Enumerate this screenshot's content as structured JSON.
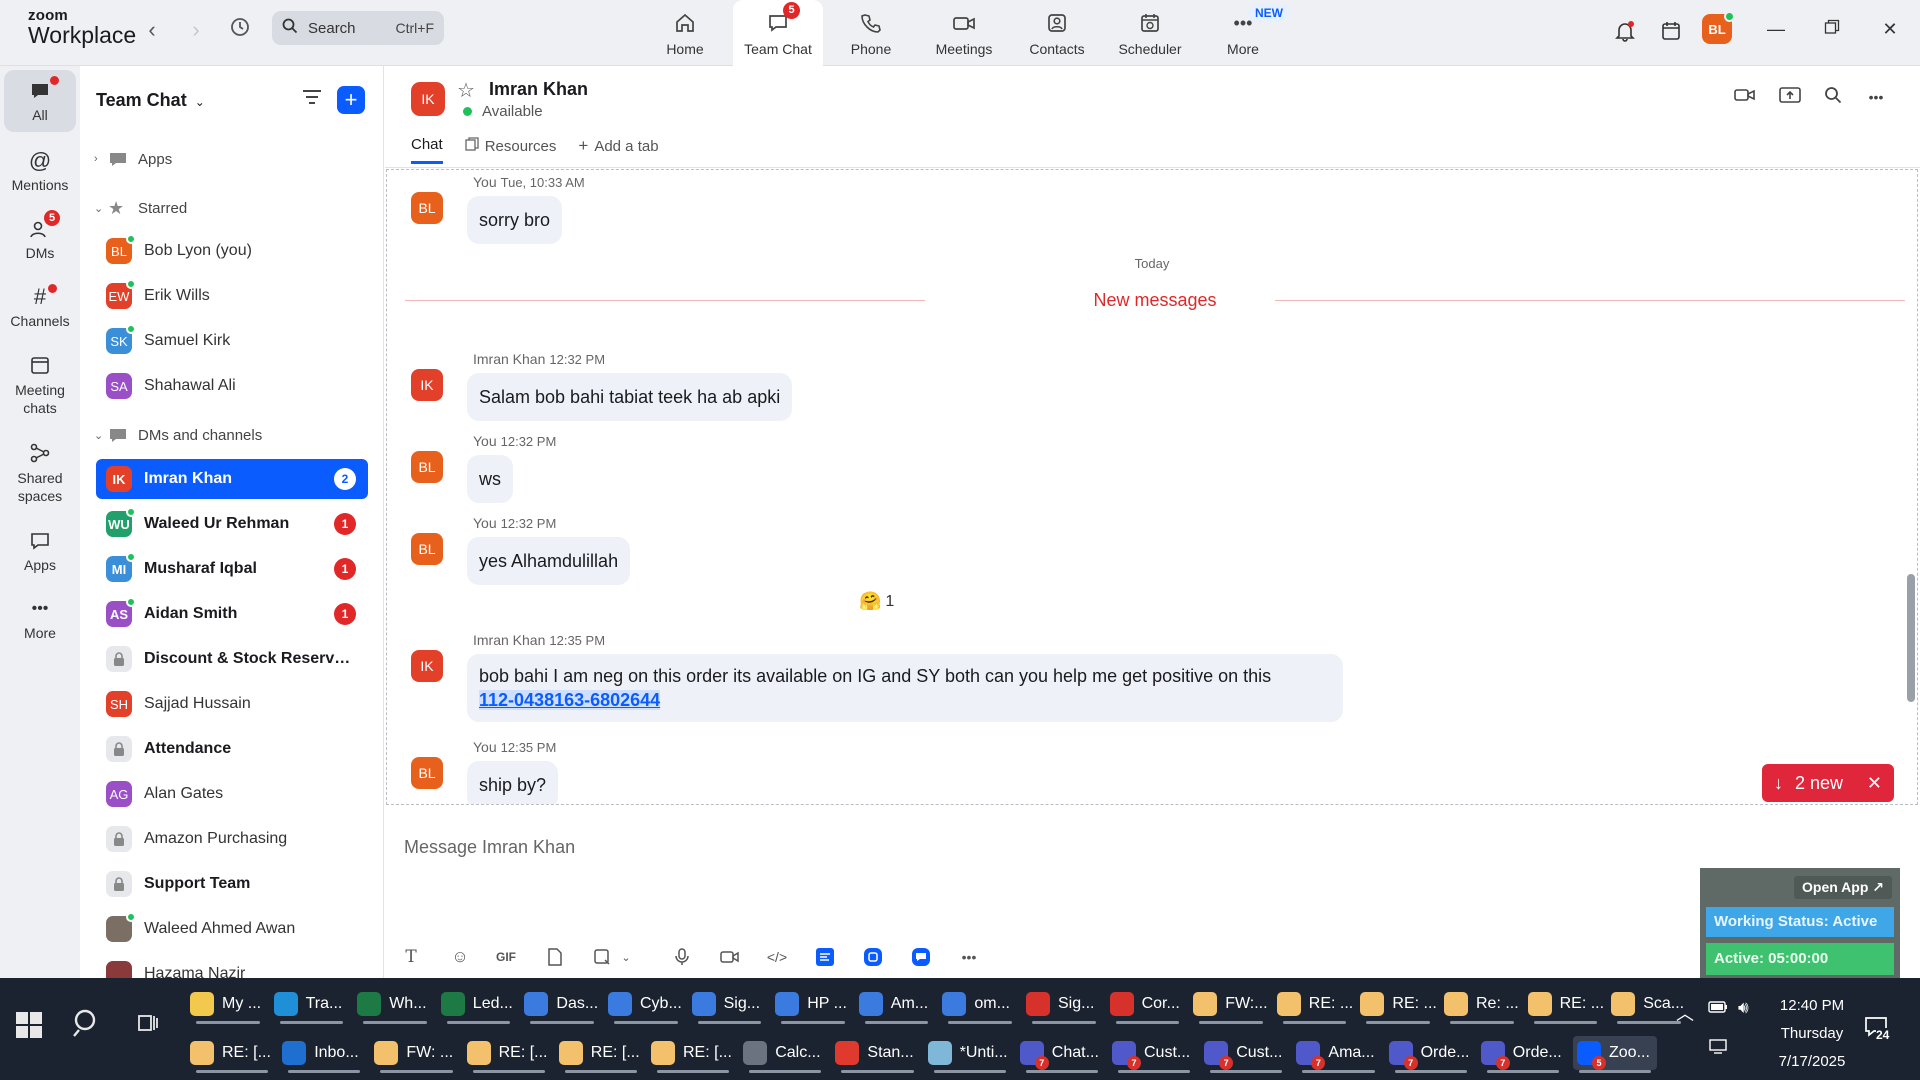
{
  "app": {
    "logo_line1": "zoom",
    "logo_line2": "Workplace"
  },
  "search": {
    "label": "Search",
    "shortcut": "Ctrl+F"
  },
  "top_tabs": [
    {
      "label": "Home",
      "icon": "home-icon"
    },
    {
      "label": "Team Chat",
      "icon": "chat-bubble-icon",
      "badge": "5",
      "active": true
    },
    {
      "label": "Phone",
      "icon": "phone-icon"
    },
    {
      "label": "Meetings",
      "icon": "video-camera-icon"
    },
    {
      "label": "Contacts",
      "icon": "contacts-icon"
    },
    {
      "label": "Scheduler",
      "icon": "calendar-clock-icon"
    },
    {
      "label": "More",
      "icon": "more-dots-icon",
      "pill": "NEW"
    }
  ],
  "user_avatar": {
    "initials": "BL",
    "color": "#e8611c"
  },
  "rail": [
    {
      "label": "All",
      "icon": "chat-bubble-icon",
      "active": true
    },
    {
      "label": "Mentions",
      "icon": "at-icon"
    },
    {
      "label": "DMs",
      "icon": "people-icon",
      "badge": "5"
    },
    {
      "label": "Channels",
      "icon": "hash-icon"
    },
    {
      "label": "Meeting chats",
      "icon": "calendar-icon"
    },
    {
      "label": "Shared spaces",
      "icon": "share-icon"
    },
    {
      "label": "Apps",
      "icon": "apps-icon"
    },
    {
      "label": "More",
      "icon": "more-dots-icon"
    }
  ],
  "sidebar": {
    "title": "Team Chat",
    "sections": {
      "apps": "Apps",
      "starred": "Starred",
      "dms": "DMs and channels"
    },
    "starred": [
      {
        "initials": "BL",
        "name": "Bob Lyon (you)",
        "color": "#e8611c"
      },
      {
        "initials": "EW",
        "name": "Erik Wills",
        "color": "#e3402a"
      },
      {
        "initials": "SK",
        "name": "Samuel Kirk",
        "color": "#3a8fd8"
      },
      {
        "initials": "SA",
        "name": "Shahawal Ali",
        "color": "#9b4fc7"
      }
    ],
    "items": [
      {
        "initials": "IK",
        "name": "Imran Khan",
        "color": "#e3402a",
        "count": "2",
        "bold": true,
        "active": true
      },
      {
        "initials": "WU",
        "name": "Waleed Ur Rehman",
        "color": "#22a06b",
        "count": "1",
        "bold": true
      },
      {
        "initials": "MI",
        "name": "Musharaf Iqbal",
        "color": "#3a8fd8",
        "count": "1",
        "bold": true
      },
      {
        "initials": "AS",
        "name": "Aidan Smith",
        "color": "#9b4fc7",
        "count": "1",
        "bold": true
      },
      {
        "lock": true,
        "name": "Discount & Stock Reserva...",
        "bold": true
      },
      {
        "initials": "SH",
        "name": "Sajjad Hussain",
        "color": "#e3402a"
      },
      {
        "lock": true,
        "name": "Attendance",
        "bold": true
      },
      {
        "initials": "AG",
        "name": "Alan Gates",
        "color": "#9b4fc7"
      },
      {
        "lock": true,
        "name": "Amazon Purchasing"
      },
      {
        "lock": true,
        "name": "Support Team",
        "bold": true
      },
      {
        "initials": "",
        "name": "Waleed Ahmed Awan",
        "color": "#7a6f62"
      },
      {
        "initials": "",
        "name": "Hazama Nazir",
        "color": "#8a3a3a"
      }
    ]
  },
  "chat": {
    "contact": {
      "initials": "IK",
      "name": "Imran Khan",
      "status": "Available"
    },
    "tabs": [
      "Chat",
      "Resources",
      "Add a tab"
    ],
    "day_separator": "Today",
    "new_messages_label": "New messages",
    "messages": [
      {
        "sender": "You",
        "time": "Tue, 10:33 AM",
        "initials": "BL",
        "color": "#e8611c",
        "text": "sorry bro"
      },
      {
        "sender": "Imran Khan",
        "time": "12:32 PM",
        "initials": "IK",
        "color": "#e3402a",
        "text": "Salam bob bahi  tabiat teek ha ab apki"
      },
      {
        "sender": "You",
        "time": "12:32 PM",
        "initials": "BL",
        "color": "#e8611c",
        "text": "ws"
      },
      {
        "sender": "You",
        "time": "12:32 PM",
        "initials": "BL",
        "color": "#e8611c",
        "text": "yes Alhamdulillah",
        "reaction": "1"
      },
      {
        "sender": "Imran Khan",
        "time": "12:35 PM",
        "initials": "IK",
        "color": "#e3402a",
        "text": "bob bahi  I am neg on this order  its available on IG and SY both can you help me get positive on this",
        "link": "112-0438163-6802644"
      },
      {
        "sender": "You",
        "time": "12:35 PM",
        "initials": "BL",
        "color": "#e8611c",
        "text": "ship by?"
      }
    ],
    "new_pill": "2 new",
    "composer_placeholder": "Message Imran Khan"
  },
  "floating_widget": {
    "open_app": "Open App ↗",
    "working_status": "Working Status: Active",
    "active_timer": "Active: 05:00:00"
  },
  "taskbar": {
    "row1": [
      {
        "label": "My ...",
        "icon": "folder-icon",
        "color": "#f2c94c"
      },
      {
        "label": "Tra...",
        "icon": "edge-icon",
        "color": "#1f8fd8"
      },
      {
        "label": "Wh...",
        "icon": "excel-icon",
        "color": "#1d7a45"
      },
      {
        "label": "Led...",
        "icon": "excel-icon",
        "color": "#1d7a45"
      },
      {
        "label": "Das...",
        "icon": "chrome-icon",
        "color": "#3b7be0"
      },
      {
        "label": "Cyb...",
        "icon": "chrome-icon",
        "color": "#3b7be0"
      },
      {
        "label": "Sig...",
        "icon": "chrome-icon",
        "color": "#3b7be0"
      },
      {
        "label": "HP ...",
        "icon": "chrome-icon",
        "color": "#3b7be0"
      },
      {
        "label": "Am...",
        "icon": "chrome-icon",
        "color": "#3b7be0"
      },
      {
        "label": "om...",
        "icon": "chrome-icon",
        "color": "#3b7be0"
      },
      {
        "label": "Sig...",
        "icon": "chrome-icon",
        "color": "#d6322b"
      },
      {
        "label": "Cor...",
        "icon": "chrome-icon",
        "color": "#d6322b"
      },
      {
        "label": "FW:...",
        "icon": "mail-icon",
        "color": "#f3c16b"
      },
      {
        "label": "RE: ...",
        "icon": "mail-icon",
        "color": "#f3c16b"
      },
      {
        "label": "RE: ...",
        "icon": "mail-icon",
        "color": "#f3c16b"
      },
      {
        "label": "Re: ...",
        "icon": "mail-icon",
        "color": "#f3c16b"
      },
      {
        "label": "RE: ...",
        "icon": "mail-icon",
        "color": "#f3c16b"
      },
      {
        "label": "Sca...",
        "icon": "mail-icon",
        "color": "#f3c16b"
      }
    ],
    "row2": [
      {
        "label": "RE: [...",
        "icon": "mail-icon",
        "color": "#f3c16b"
      },
      {
        "label": "Inbo...",
        "icon": "outlook-icon",
        "color": "#1f6fd0"
      },
      {
        "label": "FW: ...",
        "icon": "mail-icon",
        "color": "#f3c16b"
      },
      {
        "label": "RE: [...",
        "icon": "mail-icon",
        "color": "#f3c16b"
      },
      {
        "label": "RE: [...",
        "icon": "mail-icon",
        "color": "#f3c16b"
      },
      {
        "label": "RE: [...",
        "icon": "mail-icon",
        "color": "#f3c16b"
      },
      {
        "label": "Calc...",
        "icon": "calculator-icon",
        "color": "#6b7380"
      },
      {
        "label": "Stan...",
        "icon": "pdf-icon",
        "color": "#e03a2f"
      },
      {
        "label": "*Unti...",
        "icon": "notepad-icon",
        "color": "#7fb7d9"
      },
      {
        "label": "Chat...",
        "icon": "teams-icon",
        "color": "#5059c9",
        "badge": "7"
      },
      {
        "label": "Cust...",
        "icon": "teams-icon",
        "color": "#5059c9",
        "badge": "7"
      },
      {
        "label": "Cust...",
        "icon": "teams-icon",
        "color": "#5059c9",
        "badge": "7"
      },
      {
        "label": "Ama...",
        "icon": "teams-icon",
        "color": "#5059c9",
        "badge": "7"
      },
      {
        "label": "Orde...",
        "icon": "teams-icon",
        "color": "#5059c9",
        "badge": "7"
      },
      {
        "label": "Orde...",
        "icon": "teams-icon",
        "color": "#5059c9",
        "badge": "7"
      },
      {
        "label": "Zoo...",
        "icon": "zoom-icon",
        "color": "#0b5cff",
        "badge": "5",
        "selected": true
      }
    ],
    "clock_time": "12:40 PM",
    "clock_day": "Thursday",
    "clock_date": "7/17/2025",
    "notifications": "24"
  }
}
